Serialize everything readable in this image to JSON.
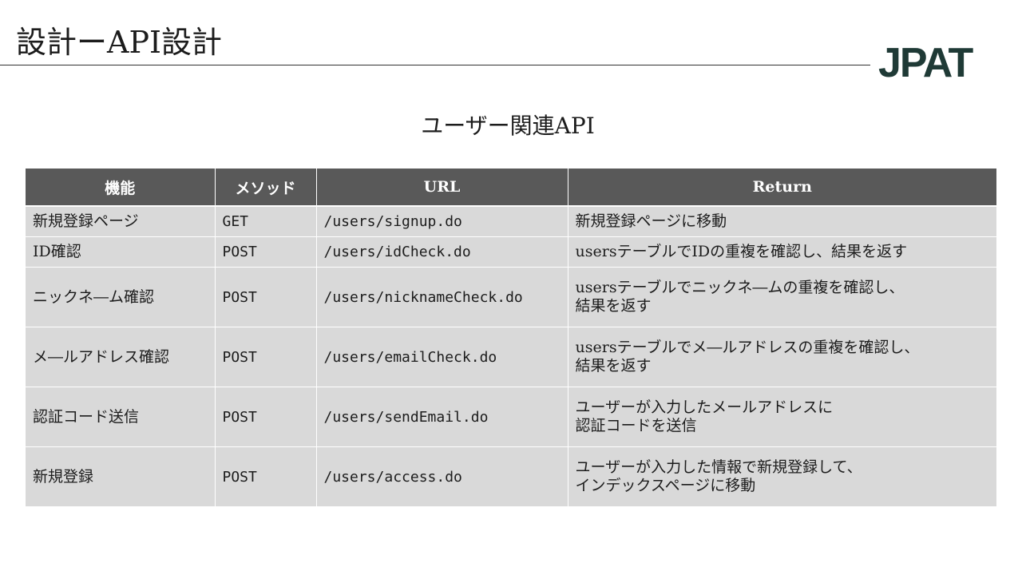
{
  "page": {
    "heading": "設計ーAPI設計",
    "logo": "JPAT",
    "section_title": "ユーザー関連API"
  },
  "table": {
    "headers": [
      "機能",
      "メソッド",
      "URL",
      "Return"
    ],
    "rows": [
      {
        "feature": "新規登録ページ",
        "method": "GET",
        "url": "/users/signup.do",
        "ret1": "新規登録ページに移動",
        "ret2": ""
      },
      {
        "feature": "ID確認",
        "method": "POST",
        "url": "/users/idCheck.do",
        "ret1": "usersテーブルでIDの重複を確認し、結果を返す",
        "ret2": ""
      },
      {
        "feature": "ニックネ―ム確認",
        "method": "POST",
        "url": "/users/nicknameCheck.do",
        "ret1": "usersテーブルでニックネ―ムの重複を確認し、",
        "ret2": "結果を返す"
      },
      {
        "feature": "メ―ルアドレス確認",
        "method": "POST",
        "url": "/users/emailCheck.do",
        "ret1": "usersテーブルでメ―ルアドレスの重複を確認し、",
        "ret2": "結果を返す"
      },
      {
        "feature": "認証コード送信",
        "method": "POST",
        "url": "/users/sendEmail.do",
        "ret1": "ユーザーが入力したメールアドレスに",
        "ret2": "認証コードを送信"
      },
      {
        "feature": "新規登録",
        "method": "POST",
        "url": "/users/access.do",
        "ret1": "ユーザーが入力した情報で新規登録して、",
        "ret2": "インデックスページに移動"
      }
    ]
  }
}
